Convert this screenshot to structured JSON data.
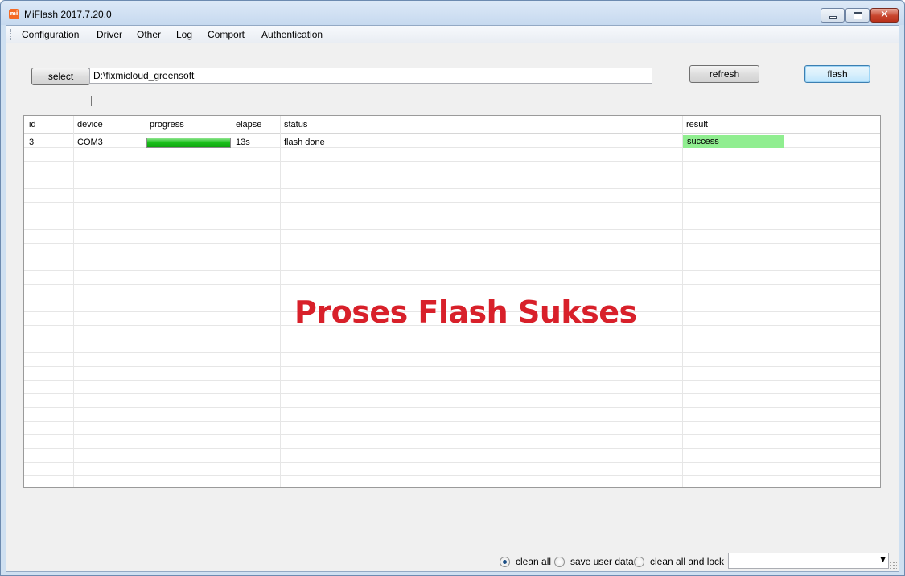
{
  "window": {
    "title": "MiFlash 2017.7.20.0",
    "icon": "mi-logo-icon",
    "icon_text": "mi",
    "close_glyph": "✕"
  },
  "menu": {
    "items": [
      "Configuration",
      "Driver",
      "Other",
      "Log",
      "Comport",
      "Authentication"
    ]
  },
  "toolbar": {
    "select_label": "select",
    "path_value": "D:\\fixmicloud_greensoft",
    "refresh_label": "refresh",
    "flash_label": "flash"
  },
  "grid": {
    "columns": [
      "id",
      "device",
      "progress",
      "elapse",
      "status",
      "result"
    ],
    "rows": [
      {
        "id": "3",
        "device": "COM3",
        "progress": 1.0,
        "elapse": "13s",
        "status": "flash done",
        "result": "success"
      }
    ]
  },
  "overlay": {
    "caption": "Proses Flash Sukses",
    "color": "#d8202a"
  },
  "footer": {
    "options": [
      {
        "label": "clean all",
        "selected": true
      },
      {
        "label": "save user data",
        "selected": false
      },
      {
        "label": "clean all and lock",
        "selected": false
      }
    ],
    "combo_value": "",
    "combo_arrow": "▼"
  },
  "colors": {
    "progress_fill": "#1cc11c",
    "result_success": "#90ee90"
  }
}
